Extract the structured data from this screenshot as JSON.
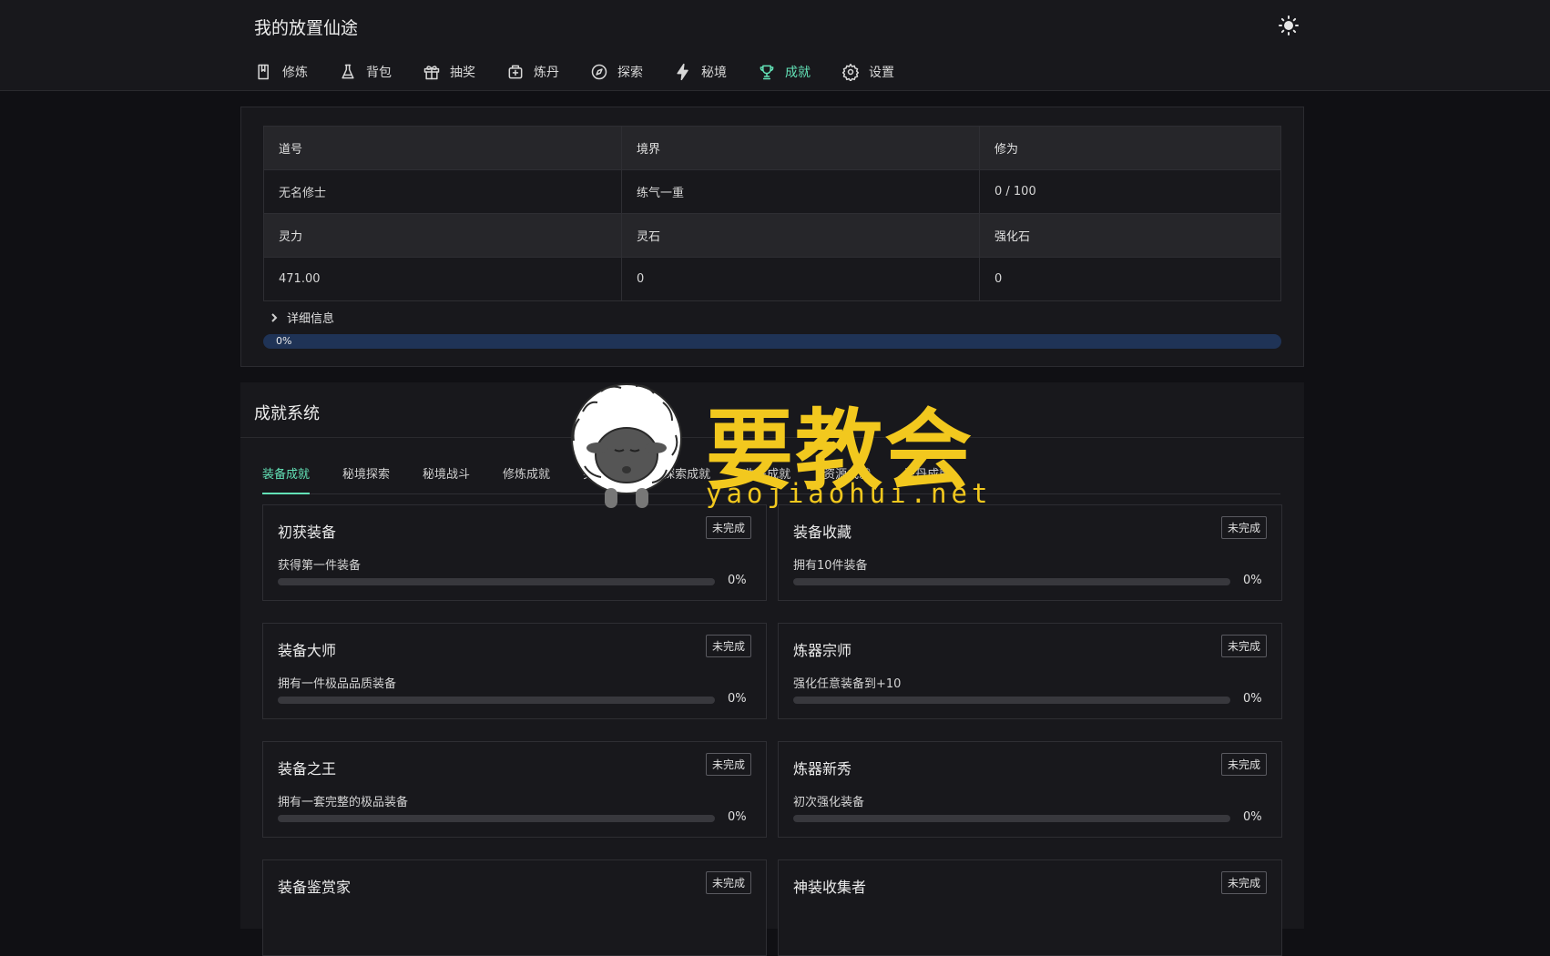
{
  "app": {
    "title": "我的放置仙途"
  },
  "nav": [
    {
      "label": "修炼",
      "icon": "book-icon"
    },
    {
      "label": "背包",
      "icon": "flask-icon"
    },
    {
      "label": "抽奖",
      "icon": "gift-icon"
    },
    {
      "label": "炼丹",
      "icon": "cauldron-icon"
    },
    {
      "label": "探索",
      "icon": "compass-icon"
    },
    {
      "label": "秘境",
      "icon": "lightning-icon"
    },
    {
      "label": "成就",
      "icon": "trophy-icon",
      "active": true
    },
    {
      "label": "设置",
      "icon": "gear-icon"
    }
  ],
  "stats": {
    "headers1": [
      "道号",
      "境界",
      "修为"
    ],
    "values1": [
      "无名修士",
      "练气一重",
      "0 / 100"
    ],
    "headers2": [
      "灵力",
      "灵石",
      "强化石"
    ],
    "values2": [
      "471.00",
      "0",
      "0"
    ]
  },
  "details_label": "详细信息",
  "progress": {
    "value": 0,
    "label": "0%"
  },
  "achievements": {
    "title": "成就系统",
    "tabs": [
      "装备成就",
      "秘境探索",
      "秘境战斗",
      "修炼成就",
      "突破成就",
      "探索成就",
      "收集成就",
      "资源成就",
      "炼丹成就"
    ],
    "cards": [
      {
        "title": "初获装备",
        "status": "未完成",
        "desc": "获得第一件装备",
        "progress": 0,
        "pct": "0%"
      },
      {
        "title": "装备收藏",
        "status": "未完成",
        "desc": "拥有10件装备",
        "progress": 0,
        "pct": "0%"
      },
      {
        "title": "装备大师",
        "status": "未完成",
        "desc": "拥有一件极品品质装备",
        "progress": 0,
        "pct": "0%"
      },
      {
        "title": "炼器宗师",
        "status": "未完成",
        "desc": "强化任意装备到+10",
        "progress": 0,
        "pct": "0%"
      },
      {
        "title": "装备之王",
        "status": "未完成",
        "desc": "拥有一套完整的极品装备",
        "progress": 0,
        "pct": "0%"
      },
      {
        "title": "炼器新秀",
        "status": "未完成",
        "desc": "初次强化装备",
        "progress": 0,
        "pct": "0%"
      },
      {
        "title": "装备鉴赏家",
        "status": "未完成",
        "desc": "",
        "progress": 0,
        "pct": ""
      },
      {
        "title": "神装收集者",
        "status": "未完成",
        "desc": "",
        "progress": 0,
        "pct": ""
      }
    ]
  },
  "watermark": {
    "text": "要教会",
    "url": "yaojiaohui.net"
  }
}
